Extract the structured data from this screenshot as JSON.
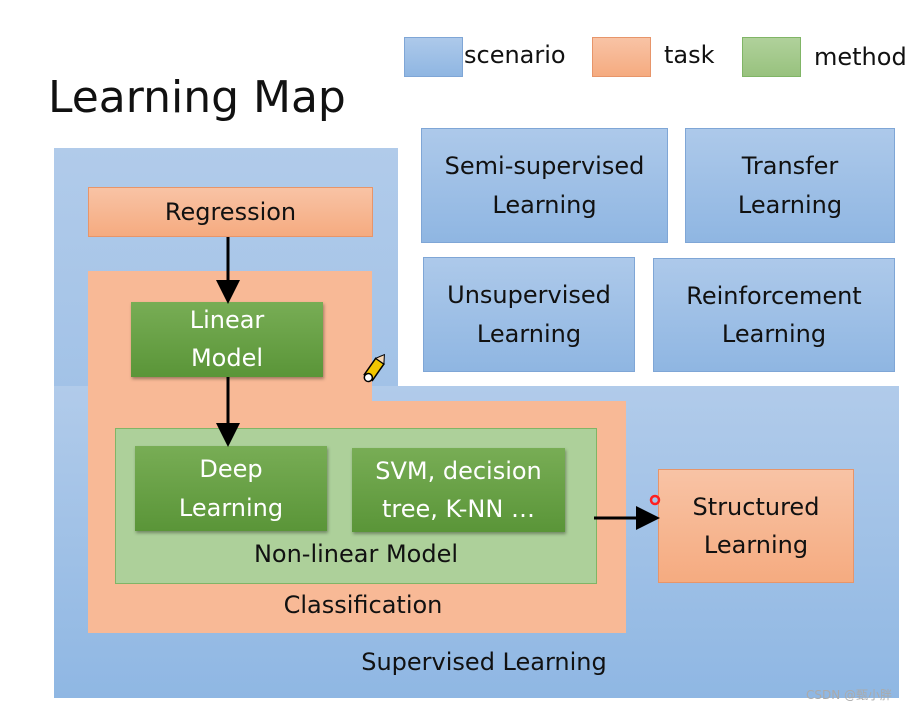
{
  "title": "Learning Map",
  "legend": [
    {
      "label": "scenario",
      "color": "#9dbfe6"
    },
    {
      "label": "task",
      "color": "#f8b48e"
    },
    {
      "label": "method",
      "color": "#a5c98e"
    }
  ],
  "scenarios": {
    "semi_supervised": "Semi-supervised\nLearning",
    "transfer": "Transfer\nLearning",
    "unsupervised": "Unsupervised\nLearning",
    "reinforcement": "Reinforcement\nLearning",
    "supervised": "Supervised Learning"
  },
  "tasks": {
    "regression": "Regression",
    "classification": "Classification",
    "structured": "Structured\nLearning"
  },
  "methods": {
    "linear_model": "Linear\nModel",
    "deep_learning": "Deep\nLearning",
    "svm": "SVM, decision\ntree, K-NN …",
    "non_linear_model": "Non-linear Model"
  },
  "watermark": "CSDN @甄小胖"
}
